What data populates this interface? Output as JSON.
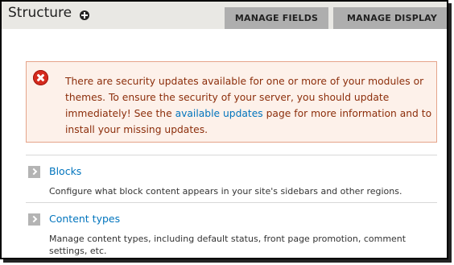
{
  "header": {
    "title": "Structure",
    "add_icon": "plus-circle-icon",
    "tabs": [
      {
        "label": "MANAGE FIELDS"
      },
      {
        "label": "MANAGE DISPLAY"
      }
    ],
    "background": "#e9e8e4",
    "tab_color": "#aeaeae"
  },
  "alert": {
    "icon": "error-icon",
    "text_before": "There are security updates available for one or more of your modules or themes. To ensure the security of your server, you should update immediately! See the ",
    "link_text": "available updates",
    "text_after": " page for more information and to install your missing updates.",
    "text_color": "#8c2e0b",
    "background": "#fdf1ea",
    "border_color": "#e5a48a"
  },
  "items": [
    {
      "icon": "chevron-right-icon",
      "title": "Blocks",
      "description": "Configure what block content appears in your site's sidebars and other regions."
    },
    {
      "icon": "chevron-right-icon",
      "title": "Content types",
      "description": "Manage content types, including default status, front page promotion, comment settings, etc."
    }
  ],
  "link_color": "#0074bd"
}
